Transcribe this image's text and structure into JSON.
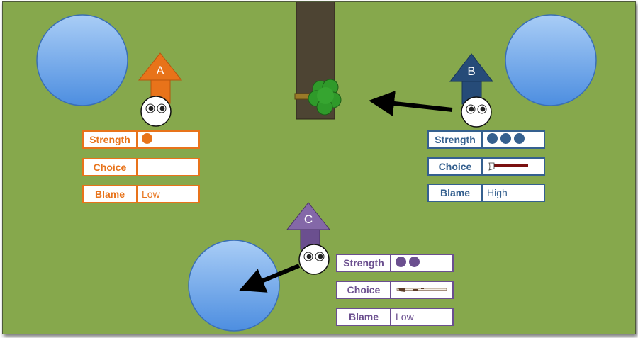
{
  "characters": [
    {
      "letter": "A",
      "color": "#e8731a",
      "strength_dots": 1,
      "choice_item": "",
      "labels": {
        "strength": "Strength",
        "choice": "Choice",
        "blame": "Blame"
      },
      "blame": "Low"
    },
    {
      "letter": "B",
      "color": "#35608f",
      "strength_dots": 3,
      "choice_item": "axe-icon",
      "labels": {
        "strength": "Strength",
        "choice": "Choice",
        "blame": "Blame"
      },
      "blame": "High"
    },
    {
      "letter": "C",
      "color": "#6b4f8f",
      "strength_dots": 2,
      "choice_item": "rifle-icon",
      "labels": {
        "strength": "Strength",
        "choice": "Choice",
        "blame": "Blame"
      },
      "blame": "Low"
    }
  ],
  "colors": {
    "background": "#86a84c",
    "pool": "#7fb1ee",
    "tree_trunk": "#4d4433",
    "foliage": "#2f9a2a",
    "arrow": "#000000"
  }
}
